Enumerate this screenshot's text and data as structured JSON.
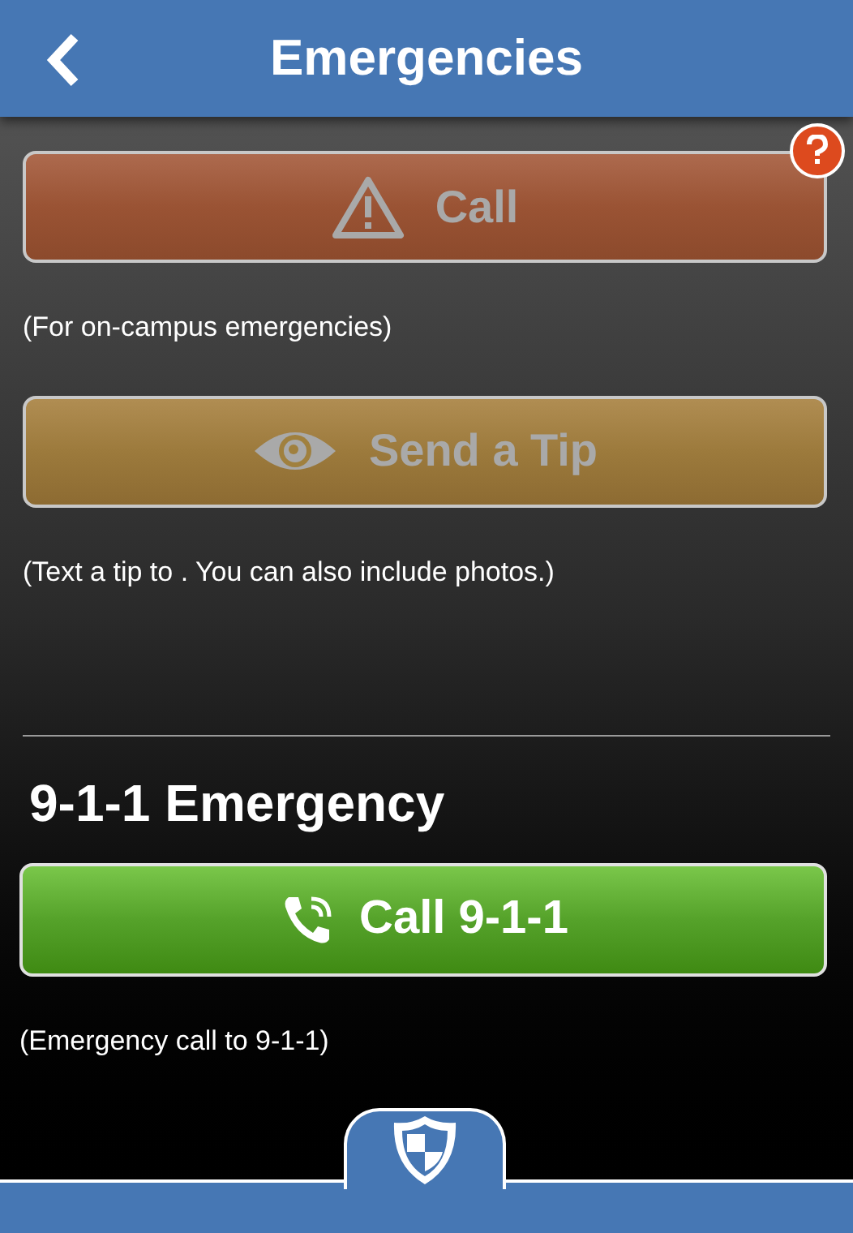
{
  "header": {
    "title": "Emergencies"
  },
  "actions": [
    {
      "kind": "call",
      "label": "Call",
      "disabled": true,
      "help": true,
      "note": "(For on-campus emergencies)"
    },
    {
      "kind": "tip",
      "label": "Send a Tip",
      "disabled": true,
      "help": false,
      "note": "(Text a tip to . You can also include photos.)"
    }
  ],
  "emergency": {
    "heading": "9-1-1 Emergency",
    "button": {
      "label": "Call 9-1-1",
      "disabled": false
    },
    "note": "(Emergency call to 9-1-1)"
  }
}
